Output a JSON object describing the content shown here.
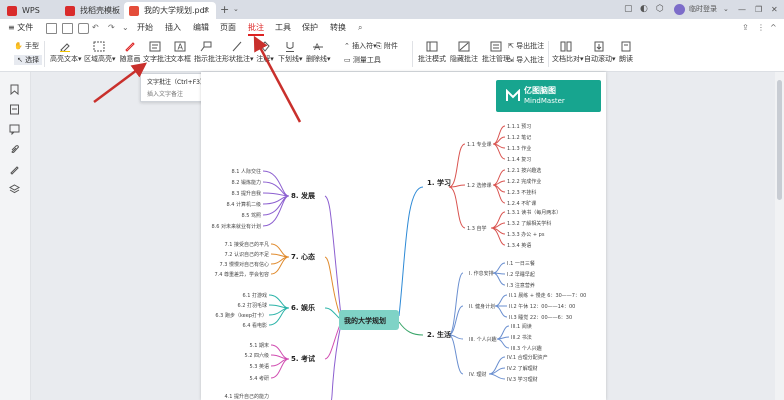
{
  "titlebar": {
    "app_label": "WPS Office",
    "tabs": [
      "找稻壳模板",
      "我的大学规划.pdf"
    ],
    "new_tab": "+",
    "login": "临时登录",
    "min": "—",
    "restore": "❐",
    "close": "✕"
  },
  "menu": {
    "file": "≡ 文件",
    "items": [
      "开始",
      "插入",
      "编辑",
      "页面",
      "批注",
      "工具",
      "保护",
      "转换"
    ]
  },
  "toolbar": {
    "hand": "手型",
    "select": "选择",
    "items": [
      "高亮文本",
      "区域高亮",
      "随意画",
      "文字批注",
      "文本框",
      "指示批注",
      "形状批注",
      "注解",
      "下划线",
      "删除线",
      "插入符",
      "测量工具",
      "附件",
      "批注模式",
      "隐藏批注",
      "批注管理",
      "导出批注",
      "导入批注",
      "文档比对",
      "自动滚动",
      "朗读"
    ]
  },
  "tooltip": {
    "title": "文字批注（Ctrl+F3）",
    "desc": "插入文字备注"
  },
  "colors": {
    "accent": "#d22d2d",
    "brand": "#17a58f",
    "arrow": "#c9302c"
  },
  "document": {
    "brand_title": "亿图脑图",
    "brand_subtitle": "MindMaster",
    "center": "我的大学规划",
    "branches": {
      "study": "1. 学习",
      "life": "2. 生活",
      "exam": "5. 考试",
      "fun": "6. 娱乐",
      "mind": "7. 心态",
      "dev": "8. 发展"
    },
    "study_sub": [
      "1.1 专业课",
      "1.2 选修课",
      "1.3 自学"
    ],
    "study_leaves": [
      "1.1.1 预习",
      "1.1.2 笔记",
      "1.1.3 作业",
      "1.1.4 复习",
      "1.2.1 按兴趣选",
      "1.2.2 完成作业",
      "1.2.3 不挂科",
      "1.2.4 不旷课",
      "1.3.1 读书（每月两本）",
      "1.3.2 了解相关学科",
      "1.3.3 办公 + ps",
      "1.3.4 英语"
    ],
    "life_sub": [
      "I. 作息安排",
      "II. 健身计划",
      "III. 个人兴趣",
      "IV. 理财"
    ],
    "life_leaves": [
      "I.1 一日三餐",
      "I.2 早睡早起",
      "I.3 注意营养",
      "II.1 晨练 + 慢走 6：30——7：00",
      "II.2 午休 12：00——14：00",
      "II.3 睡觉 22：00——6：30",
      "III.1 阅读",
      "III.2 书法",
      "III.3 个人兴趣",
      "IV.1 合理分配资产",
      "IV.2 了解理财",
      "IV.3 学习理财"
    ],
    "exam_leaves": [
      "5.1 期末",
      "5.2 四六级",
      "5.3 英语",
      "5.4 考研"
    ],
    "fun_leaves": [
      "6.1 打游戏",
      "6.2 打羽毛球",
      "6.3 跑步（keep打卡）",
      "6.4 看电影"
    ],
    "mind_leaves": [
      "7.1 接受自己的平凡",
      "7.2 认识自己的不足",
      "7.3 慢慢对自己有信心",
      "7.4 尊重差异，学会包容"
    ],
    "dev_leaves": [
      "8.1 人际交往",
      "8.2 锻炼能力",
      "8.3 提升自我",
      "8.4 计算机二级",
      "8.5 驾照",
      "8.6 对未来就业有计划"
    ],
    "bottom_leaf": "4.1 提升自己的能力"
  }
}
